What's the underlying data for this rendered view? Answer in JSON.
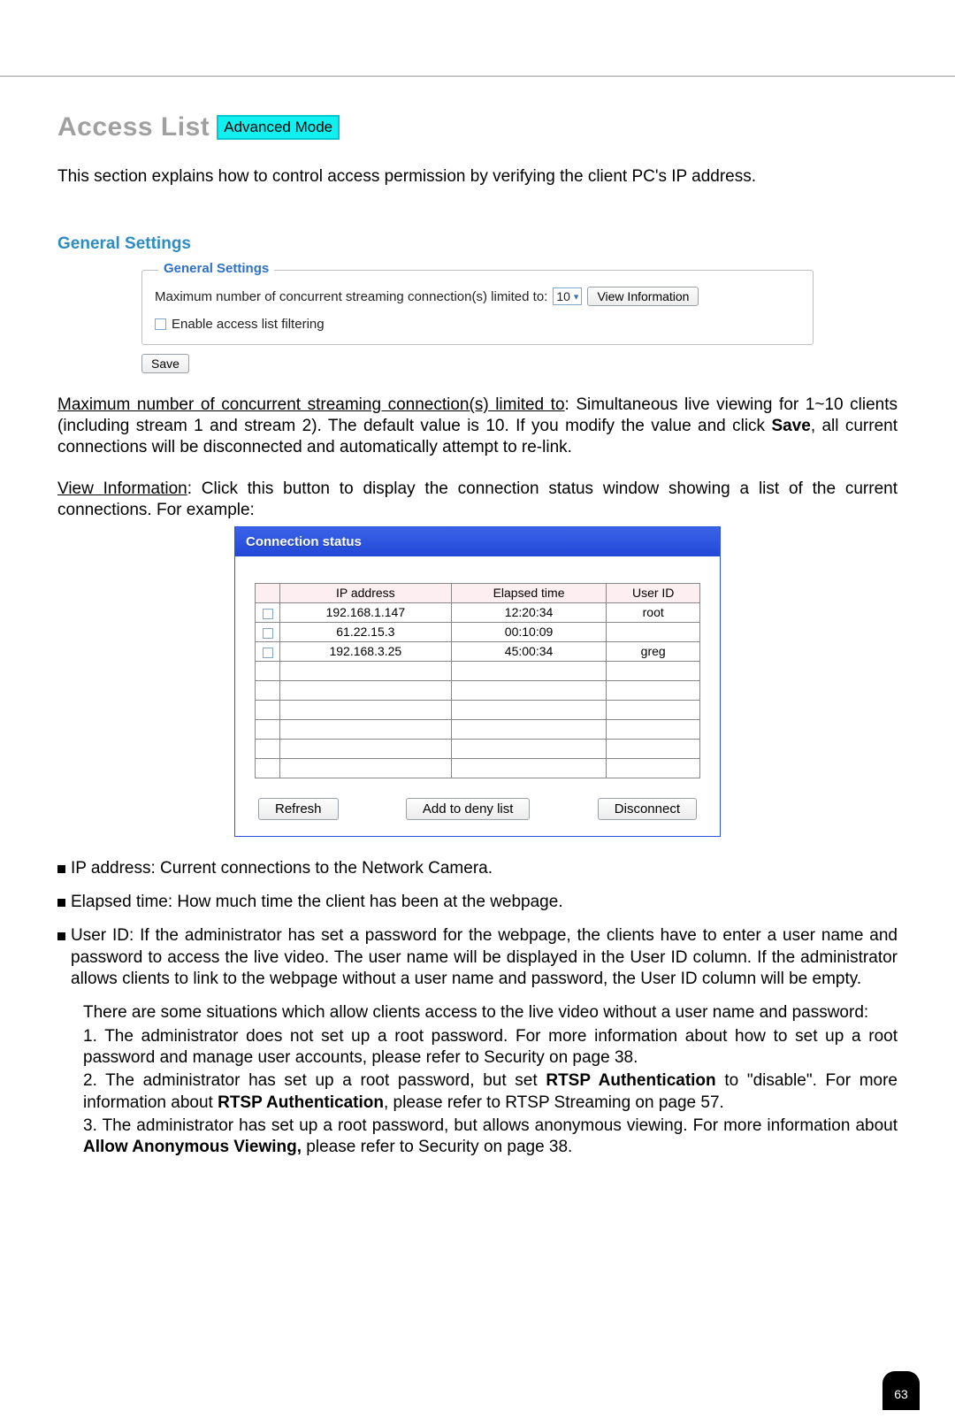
{
  "header": {
    "title": "Access List",
    "mode_badge": "Advanced Mode"
  },
  "intro": "This section explains how to control access permission by verifying the client PC's IP address.",
  "general_settings": {
    "section_label": "General Settings",
    "legend": "General Settings",
    "max_conn_label": "Maximum number of concurrent streaming connection(s) limited to:",
    "max_conn_value": "10",
    "view_info_btn": "View Information",
    "enable_filter_label": "Enable access list filtering",
    "save_btn": "Save"
  },
  "paragraphs": {
    "max_conn_head": "Maximum number of concurrent streaming connection(s) limited to",
    "max_conn_rest": ": Simultaneous live viewing for 1~10 clients (including stream 1 and stream 2). The default value is 10. If you modify the value and click ",
    "save_word": "Save",
    "max_conn_tail": ", all current connections will be disconnected and automatically attempt to re-link.",
    "view_info_head": "View Information",
    "view_info_rest": ": Click this button to display the connection status window showing a list of the current connections. For example:"
  },
  "connection_panel": {
    "title": "Connection status",
    "columns": [
      "IP address",
      "Elapsed time",
      "User ID"
    ],
    "rows": [
      {
        "ip": "192.168.1.147",
        "elapsed": "12:20:34",
        "user": "root"
      },
      {
        "ip": "61.22.15.3",
        "elapsed": "00:10:09",
        "user": ""
      },
      {
        "ip": "192.168.3.25",
        "elapsed": "45:00:34",
        "user": "greg"
      }
    ],
    "buttons": {
      "refresh": "Refresh",
      "add_deny": "Add to deny list",
      "disconnect": "Disconnect"
    }
  },
  "bullets": {
    "ip_desc": "IP address: Current connections to the Network Camera.",
    "elapsed_desc": "Elapsed time: How much time the client has been at the webpage.",
    "userid_desc": "User ID: If the administrator has set a password for the webpage, the clients have to enter a user name and password to access the live video. The user name will be displayed in the User ID column. If  the administrator allows clients to link to the webpage without a user name and password, the User ID column will be empty.",
    "situations_intro": "There are some situations which allow clients access to the live video without a user name and password:",
    "sit1": "1. The administrator does not set up a root password. For more information about how to set up a root password and manage user accounts, please refer to Security on page 38.",
    "sit2a": "2. The administrator has set up a root password, but set ",
    "sit2b": "RTSP Authentication",
    "sit2c": " to \"disable\". For more information about ",
    "sit2d": "RTSP Authentication",
    "sit2e": ", please refer to RTSP Streaming on page 57.",
    "sit3a": "3. The administrator has set up a root password, but allows anonymous viewing. For more information about ",
    "sit3b": "Allow Anonymous Viewing,",
    "sit3c": " please refer to Security on page 38."
  },
  "page_number": "63"
}
